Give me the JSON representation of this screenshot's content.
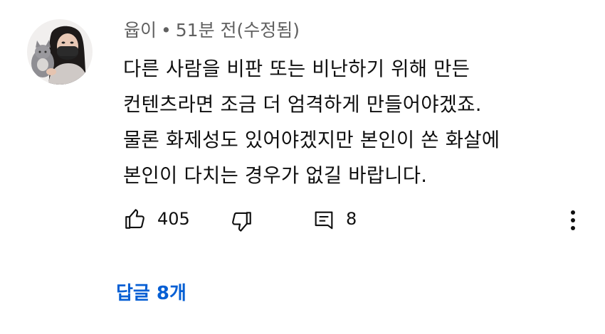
{
  "comment": {
    "author": "윱이",
    "separator": "•",
    "time": "51분 전(수정됨)",
    "lines": [
      "다른 사람을 비판 또는 비난하기 위해 만든",
      "컨텐츠라면 조금 더 엄격하게 만들어야겠죠.",
      "물론 화제성도 있어야겠지만 본인이 쏜 화살에",
      "본인이 다치는 경우가 없길 바랍니다."
    ],
    "like_count": "405",
    "reply_count": "8",
    "replies_label": "답글 8개"
  },
  "icons": {
    "avatar": "avatar-photo",
    "like": "thumbs-up-icon",
    "dislike": "thumbs-down-icon",
    "reply": "comment-icon",
    "more": "more-vertical-icon"
  },
  "colors": {
    "text": "#0f0f0f",
    "meta": "#606060",
    "link": "#065fd4",
    "background": "#ffffff"
  }
}
